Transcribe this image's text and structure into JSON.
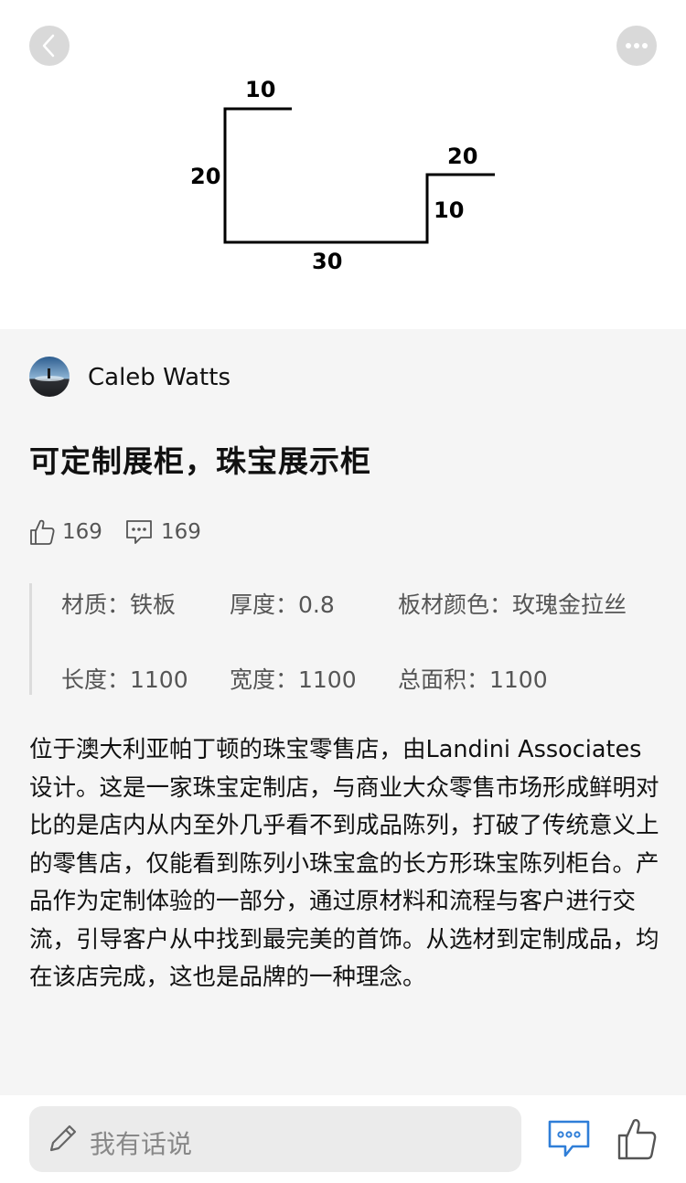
{
  "header": {
    "back_icon": "chevron-left-icon",
    "more_icon": "ellipsis-icon"
  },
  "drawing": {
    "labels": {
      "top_flange": "10",
      "left_height": "20",
      "bottom_length": "30",
      "right_flange": "20",
      "right_height": "10"
    }
  },
  "post": {
    "author": "Caleb Watts",
    "title": "可定制展柜，珠宝展示柜",
    "likes": "169",
    "comments": "169",
    "specs": {
      "material": "材质：铁板",
      "thickness": "厚度：0.8",
      "color": "板材颜色：玫瑰金拉丝",
      "length": "长度：1100",
      "width": "宽度：1100",
      "area": "总面积：1100"
    },
    "description": "位于澳大利亚帕丁顿的珠宝零售店，由Landini Associates设计。这是一家珠宝定制店，与商业大众零售市场形成鲜明对比的是店内从内至外几乎看不到成品陈列，打破了传统意义上的零售店，仅能看到陈列小珠宝盒的长方形珠宝陈列柜台。产品作为定制体验的一部分，通过原材料和流程与客户进行交流，引导客户从中找到最完美的首饰。从选材到定制成品，均在该店完成，这也是品牌的一种理念。"
  },
  "bottom_bar": {
    "input_placeholder": "我有话说",
    "comment_icon": "comment-icon",
    "like_icon": "thumbs-up-icon"
  },
  "colors": {
    "accent_blue": "#2f7ed8",
    "content_bg": "#f5f5f5",
    "text_muted": "#555555"
  }
}
